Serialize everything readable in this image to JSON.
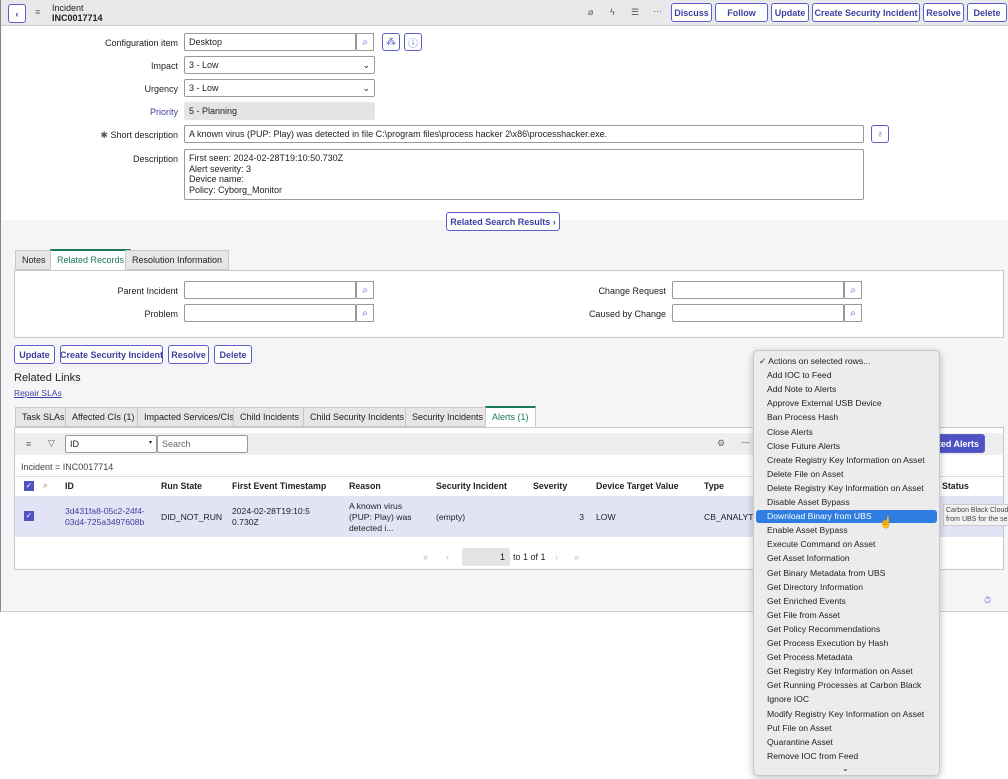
{
  "header": {
    "title": "Incident",
    "number": "INC0017714",
    "buttons": [
      "Discuss",
      "Follow",
      "Update",
      "Create Security Incident",
      "Resolve",
      "Delete"
    ]
  },
  "form": {
    "config_item": {
      "label": "Configuration item",
      "value": "Desktop"
    },
    "impact": {
      "label": "Impact",
      "value": "3 - Low"
    },
    "urgency": {
      "label": "Urgency",
      "value": "3 - Low"
    },
    "priority": {
      "label": "Priority",
      "value": "5 - Planning"
    },
    "short_description": {
      "label": "Short description",
      "value": "A known virus (PUP: Play) was detected in file C:\\program files\\process hacker 2\\x86\\processhacker.exe."
    },
    "description": {
      "label": "Description",
      "lines": [
        "First seen: 2024-02-28T19:10:50.730Z",
        "Alert severity: 3",
        "Device name:",
        "Policy: Cyborg_Monitor"
      ]
    },
    "related_search": "Related Search Results"
  },
  "section_tabs": [
    "Notes",
    "Related Records",
    "Resolution Information"
  ],
  "related_records": {
    "parent_incident": "Parent Incident",
    "problem": "Problem",
    "change_request": "Change Request",
    "caused_by_change": "Caused by Change"
  },
  "bottom_buttons": [
    "Update",
    "Create Security Incident",
    "Resolve",
    "Delete"
  ],
  "related_links": {
    "title": "Related Links",
    "repair": "Repair SLAs"
  },
  "list_tabs": [
    "Task SLAs",
    "Affected CIs (1)",
    "Impacted Services/CIs",
    "Child Incidents",
    "Child Security Incidents",
    "Security Incidents",
    "Alerts (1)"
  ],
  "list": {
    "search_field": "ID",
    "search_placeholder": "Search",
    "filter": "Incident = INC0017714",
    "action_button": "cted Alerts",
    "columns": [
      "ID",
      "Run State",
      "First Event Timestamp",
      "Reason",
      "Security Incident",
      "Severity",
      "Device Target Value",
      "Type",
      "Status"
    ],
    "row": {
      "id": "3d431fa8-05c2-24f4-03d4-725a3497608b",
      "run_state": "DID_NOT_RUN",
      "timestamp": "2024-02-28T19:10:50.730Z",
      "reason": "A known virus (PUP: Play) was detected i...",
      "security_incident": "(empty)",
      "severity": "3",
      "device_target": "LOW",
      "type": "CB_ANALYTI"
    },
    "pagination": {
      "page": "1",
      "range": "to 1 of 1"
    }
  },
  "menu": {
    "items": [
      "Actions on selected rows...",
      "Add IOC to Feed",
      "Add Note to Alerts",
      "Approve External USB Device",
      "Ban Process Hash",
      "Close Alerts",
      "Close Future Alerts",
      "Create Registry Key Information on Asset",
      "Delete File on Asset",
      "Delete Registry Key Information on Asset",
      "Disable Asset Bypass",
      "Download Binary from UBS",
      "Enable Asset Bypass",
      "Execute Command on Asset",
      "Get Asset Information",
      "Get Binary Metadata from UBS",
      "Get Directory Information",
      "Get Enriched Events",
      "Get File from Asset",
      "Get Policy Recommendations",
      "Get Process Execution by Hash",
      "Get Process Metadata",
      "Get Registry Key Information on Asset",
      "Get Running Processes at Carbon Black",
      "Ignore IOC",
      "Modify Registry Key Information on Asset",
      "Put File on Asset",
      "Quarantine Asset",
      "Remove IOC from Feed"
    ],
    "highlighted": "Download Binary from UBS"
  },
  "tooltip": [
    "Carbon Black Cloud",
    "from UBS for the se"
  ],
  "colors": {
    "accent": "#5b5fc7",
    "highlight": "#2f7de1",
    "active_tab": "#1b7a54"
  }
}
